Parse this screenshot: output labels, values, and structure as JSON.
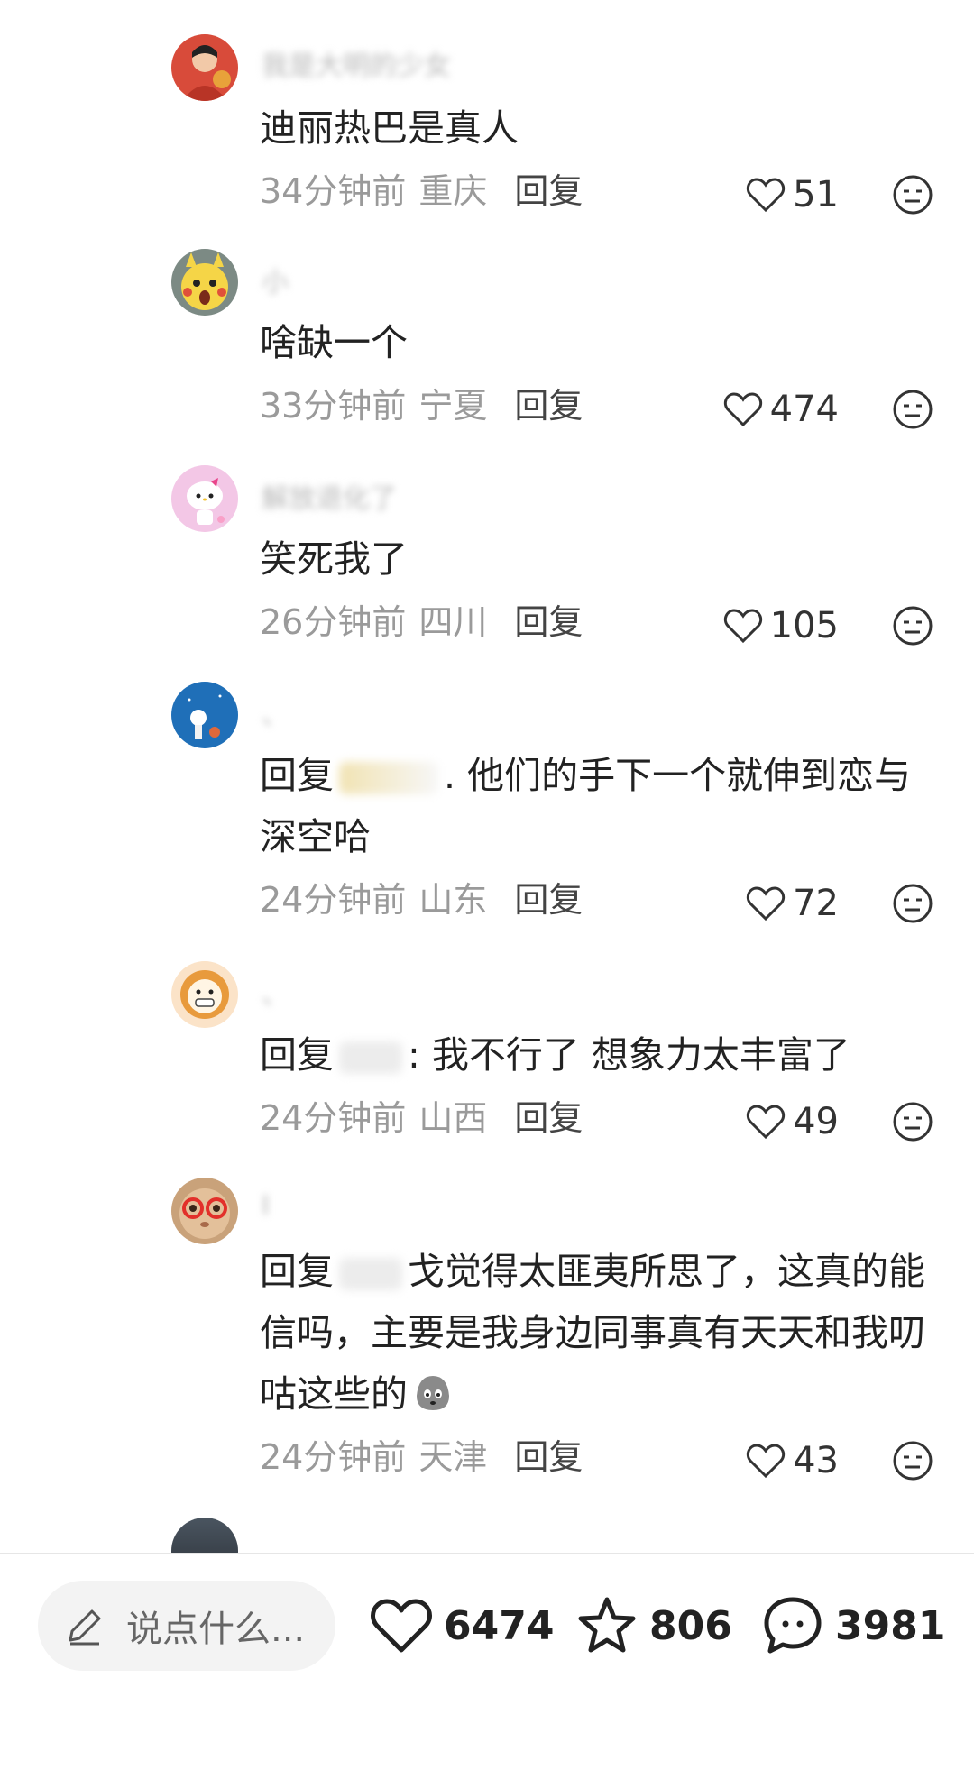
{
  "comments": [
    {
      "username": "我是大明的少女",
      "content": "迪丽热巴是真人",
      "time": "34分钟前",
      "location": "重庆",
      "reply_label": "回复",
      "likes": "51"
    },
    {
      "username": "小",
      "content": "啥缺一个",
      "time": "33分钟前",
      "location": "宁夏",
      "reply_label": "回复",
      "likes": "474"
    },
    {
      "username": "解放退化了",
      "content": "笑死我了",
      "time": "26分钟前",
      "location": "四川",
      "reply_label": "回复",
      "likes": "105"
    },
    {
      "username": "、",
      "reply_prefix": "回复",
      "content": ". 他们的手下一个就伸到恋与深空哈",
      "time": "24分钟前",
      "location": "山东",
      "reply_label": "回复",
      "likes": "72"
    },
    {
      "username": "、",
      "reply_prefix": "回复",
      "content": ": 我不行了 想象力太丰富了",
      "time": "24分钟前",
      "location": "山西",
      "reply_label": "回复",
      "likes": "49"
    },
    {
      "username": "I",
      "reply_prefix": "回复",
      "content": "戈觉得太匪夷所思了，这真的能信吗，主要是我身边同事真有天天和我叨咕这些的",
      "time": "24分钟前",
      "location": "天津",
      "reply_label": "回复",
      "likes": "43"
    }
  ],
  "bottom_bar": {
    "input_placeholder": "说点什么...",
    "likes_count": "6474",
    "favorites_count": "806",
    "comments_count": "3981"
  }
}
